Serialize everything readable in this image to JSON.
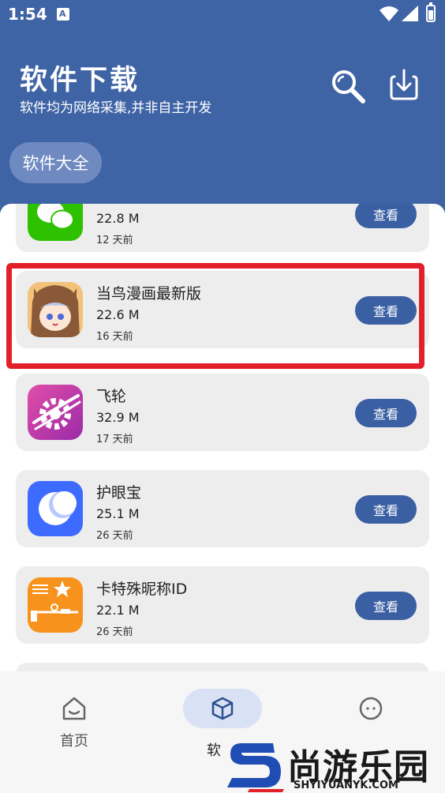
{
  "status_bar": {
    "time": "1:54",
    "notification_letter": "A"
  },
  "header": {
    "title": "软件下载",
    "subtitle": "软件均为网络采集,并非自主开发",
    "category_chip": "软件大全"
  },
  "apps": [
    {
      "name": "",
      "size": "22.8 M",
      "date": "12 天前",
      "button": "查看",
      "icon": "wechat-icon"
    },
    {
      "name": "当鸟漫画最新版",
      "size": "22.6 M",
      "date": "16 天前",
      "button": "查看",
      "icon": "anime-girl-icon"
    },
    {
      "name": "飞轮",
      "size": "32.9 M",
      "date": "17 天前",
      "button": "查看",
      "icon": "gear-wheel-icon"
    },
    {
      "name": "护眼宝",
      "size": "25.1 M",
      "date": "26 天前",
      "button": "查看",
      "icon": "moon-icon"
    },
    {
      "name": "卡特殊昵称ID",
      "size": "22.1 M",
      "date": "26 天前",
      "button": "查看",
      "icon": "nickname-icon"
    }
  ],
  "bottom_nav": {
    "home_label": "首页",
    "software_label": "软",
    "more_label": ""
  },
  "watermark": {
    "text": "尚游乐园",
    "url": "SHYIYUANYK.COM"
  },
  "colors": {
    "brand_blue": "#3f64a6",
    "button_blue": "#3a5fa3",
    "highlight_red": "#e2202a"
  }
}
